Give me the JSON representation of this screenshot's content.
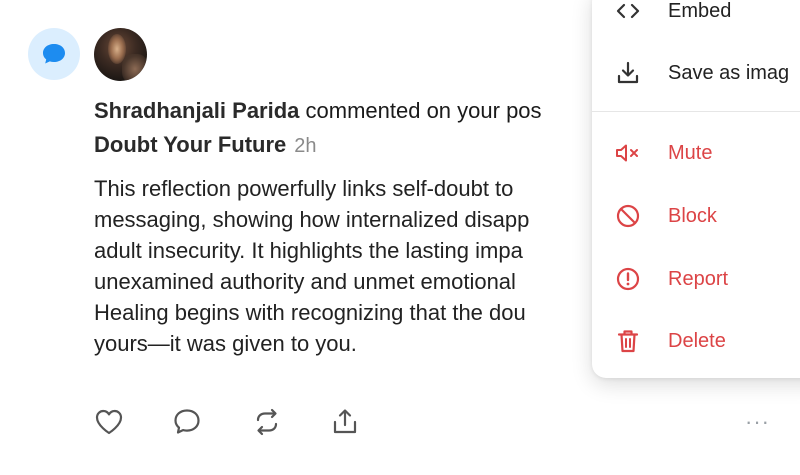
{
  "notification": {
    "author": "Shradhanjali Parida",
    "action_text": " commented on your pos",
    "post_title": "Doubt Your Future",
    "time": "2h",
    "body_lines": [
      "This reflection powerfully links self-doubt to",
      "messaging, showing how internalized disapp",
      "adult insecurity. It highlights the lasting impa",
      "unexamined authority and unmet emotional",
      "Healing begins with recognizing that the dou",
      "yours—it was given to you."
    ]
  },
  "actions": {
    "like_icon": "heart-icon",
    "reply_icon": "comment-icon",
    "repost_icon": "repost-icon",
    "share_icon": "share-icon",
    "more": "···"
  },
  "menu": {
    "items": [
      {
        "label": "Embed",
        "icon": "code-icon"
      },
      {
        "label": "Save as imag",
        "icon": "download-icon"
      },
      {
        "label": "Mute",
        "icon": "mute-icon"
      },
      {
        "label": "Block",
        "icon": "block-icon"
      },
      {
        "label": "Report",
        "icon": "report-icon"
      },
      {
        "label": "Delete",
        "icon": "trash-icon"
      }
    ]
  },
  "colors": {
    "danger": "#dc4446",
    "badge_bg": "#dbeefe",
    "badge_icon": "#1d8cf0",
    "icon_gray": "#555555"
  }
}
